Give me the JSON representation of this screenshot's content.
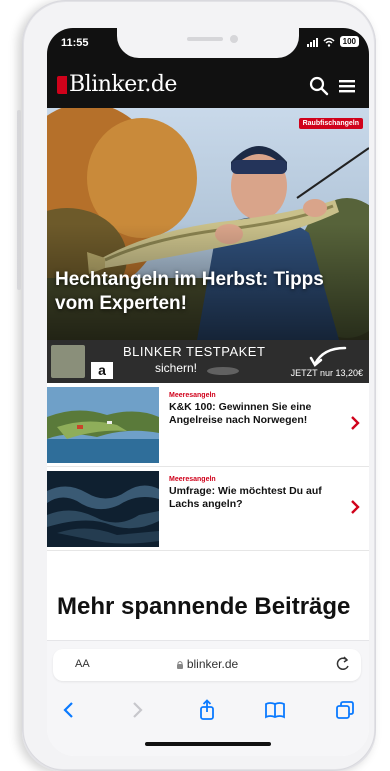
{
  "status": {
    "time": "11:55",
    "battery": "100"
  },
  "site": {
    "logo": "Blinker.de"
  },
  "hero": {
    "badge": "Raubfischangeln",
    "title": "Hechtangeln im Herbst: Tipps vom Experten!"
  },
  "ad": {
    "line1": "BLINKER TESTPAKET",
    "line2": "sichern!",
    "cta": "JETZT nur 13,20€",
    "amazon": "a"
  },
  "articles": [
    {
      "category": "Meeresangeln",
      "title": "K&K 100: Gewinnen Sie eine Angelreise nach Norwegen!"
    },
    {
      "category": "Meeresangeln",
      "title": "Umfrage: Wie möchtest Du auf Lachs angeln?"
    }
  ],
  "more": {
    "title": "Mehr spannende Beiträge"
  },
  "browser": {
    "text_size": "AA",
    "url": "blinker.de"
  },
  "icons": {
    "search": "search-icon",
    "menu": "hamburger-menu-icon",
    "chevron": "chevron-right-icon",
    "back": "chevron-left-icon",
    "forward": "chevron-right-icon",
    "share": "share-icon",
    "bookmarks": "book-icon",
    "tabs": "tabs-icon",
    "reload": "reload-icon"
  },
  "colors": {
    "accent": "#d0021b",
    "header": "#111111",
    "ios_blue": "#0a7aff"
  }
}
